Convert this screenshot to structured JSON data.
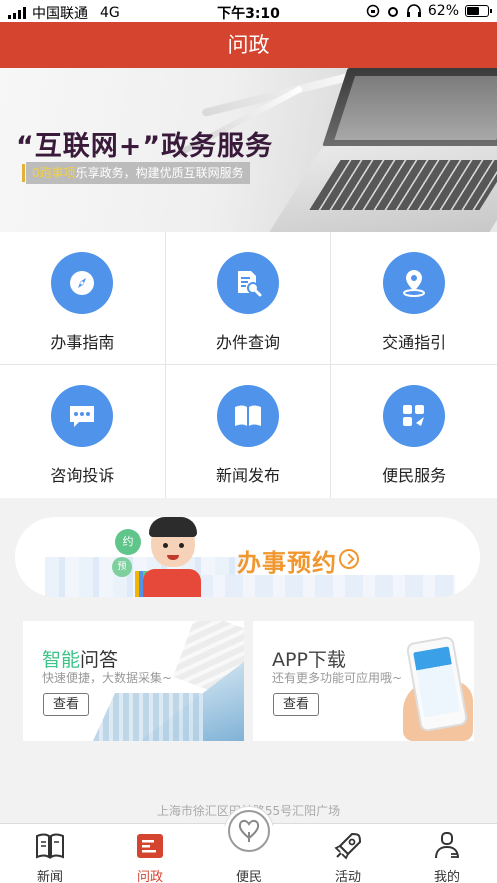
{
  "status_bar": {
    "carrier": "中国联通",
    "network": "4G",
    "time": "下午3:10",
    "battery": "62%",
    "battery_level": 0.62
  },
  "header": {
    "title": "问政"
  },
  "banner": {
    "title": "“互联网+”政务服务",
    "subtitle_highlight": "0跑事项",
    "subtitle_rest": "乐享政务，构建优质互联网服务"
  },
  "services": [
    {
      "label": "办事指南",
      "icon": "compass-icon"
    },
    {
      "label": "办件查询",
      "icon": "document-search-icon"
    },
    {
      "label": "交通指引",
      "icon": "location-pin-icon"
    },
    {
      "label": "咨询投诉",
      "icon": "chat-bubble-icon"
    },
    {
      "label": "新闻发布",
      "icon": "book-icon"
    },
    {
      "label": "便民服务",
      "icon": "apps-icon"
    }
  ],
  "appointment": {
    "label": "办事预约",
    "bubble_1": "约",
    "bubble_2": "预"
  },
  "cards": {
    "qa": {
      "title_green": "智能",
      "title_rest": "问答",
      "subtitle": "快速便捷，大数据采集~",
      "button": "查看"
    },
    "app": {
      "title": "APP下载",
      "subtitle": "还有更多功能可应用哦~",
      "button": "查看"
    }
  },
  "address": "上海市徐汇区田林路55号汇阳广场",
  "tabs": [
    {
      "label": "新闻",
      "icon": "newspaper-icon",
      "active": false
    },
    {
      "label": "问政",
      "icon": "inquiry-icon",
      "active": true
    },
    {
      "label": "便民",
      "icon": "heart-hands-icon",
      "active": false
    },
    {
      "label": "活动",
      "icon": "rocket-icon",
      "active": false
    },
    {
      "label": "我的",
      "icon": "user-icon",
      "active": false
    }
  ],
  "colors": {
    "brand_red": "#d4442f",
    "icon_blue": "#4f93ea",
    "accent_orange": "#f0972f",
    "accent_green": "#3cc386"
  }
}
